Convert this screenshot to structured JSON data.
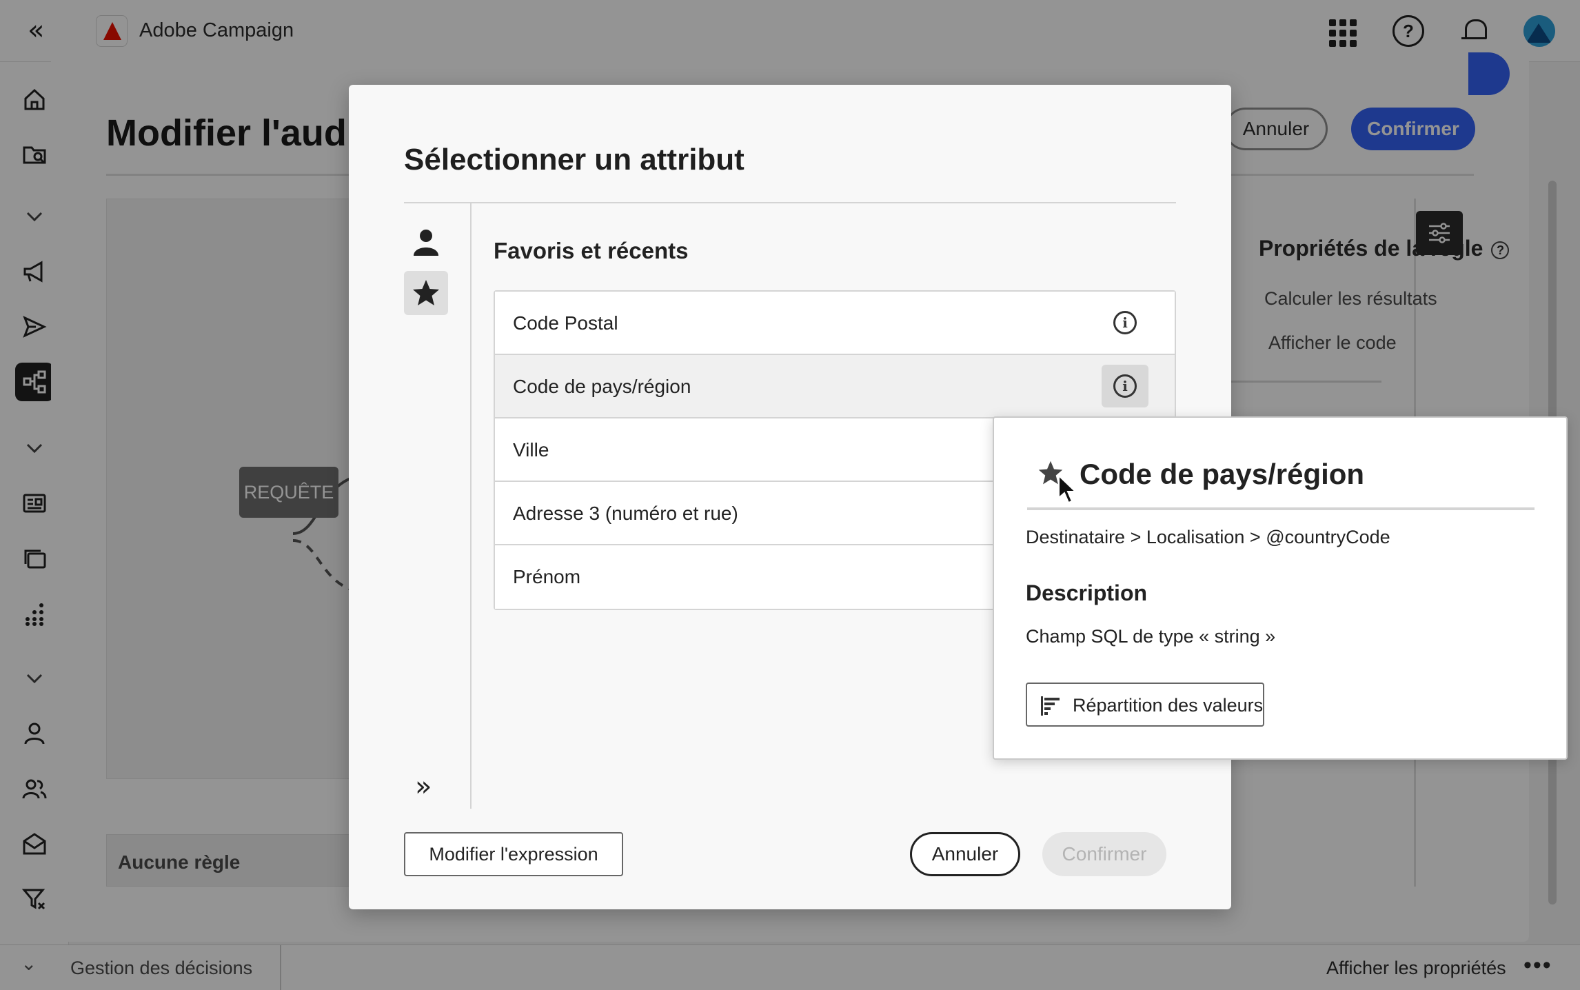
{
  "topbar": {
    "app_title": "Adobe Campaign",
    "brand_color": "#eb1000",
    "icons": [
      "collapse-icon",
      "adobe-logo",
      "apps-grid-icon",
      "help-icon",
      "bell-icon",
      "avatar"
    ]
  },
  "leftnav": {
    "icons": [
      "home-icon",
      "folder-search-icon",
      "chevron-down-icon",
      "megaphone-icon",
      "send-icon",
      "workflow-icon",
      "chevron-down-icon",
      "content-icon",
      "layers-icon",
      "dots-grid-icon",
      "chevron-down-icon",
      "user-icon",
      "users-icon",
      "mail-icon",
      "filter-icon"
    ],
    "active": "workflow-icon"
  },
  "bottombar": {
    "section_label": "Gestion des décisions",
    "properties_label": "Afficher les propriétés",
    "more": "•••"
  },
  "panel": {
    "title": "Modifier l'audience",
    "cancel_label": "Annuler",
    "confirm_label": "Confirmer",
    "accent_color": "#3562f5",
    "query_node_label": "REQUÊTE",
    "no_rule_label": "Aucune règle",
    "rule_heading": "Propriétés de la règle",
    "rule_line1": "Calculer les résultats",
    "rule_line2": "Afficher le code"
  },
  "modal": {
    "title": "Sélectionner un attribut",
    "list_heading": "Favoris et récents",
    "attributes": [
      {
        "label": "Code Postal"
      },
      {
        "label": "Code de pays/région"
      },
      {
        "label": "Ville"
      },
      {
        "label": "Adresse 3 (numéro et rue)"
      },
      {
        "label": "Prénom"
      }
    ],
    "modify_expression_label": "Modifier l'expression",
    "cancel_label": "Annuler",
    "confirm_label": "Confirmer",
    "expand_glyph": "»"
  },
  "popover": {
    "title": "Code de pays/région",
    "path": "Destinataire > Localisation > @countryCode",
    "description_heading": "Description",
    "description": "Champ SQL de type « string »",
    "distribution_button": "Répartition des valeurs"
  }
}
